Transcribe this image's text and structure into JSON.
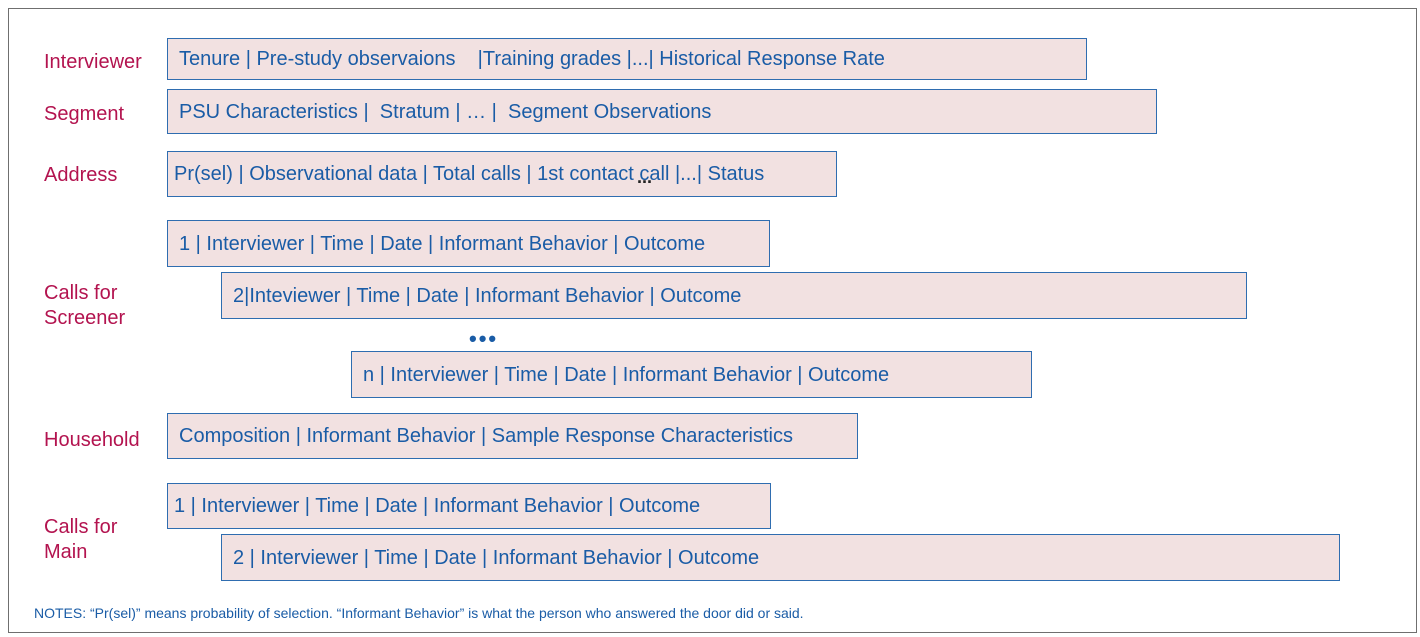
{
  "labels": {
    "interviewer": "Interviewer",
    "segment": "Segment",
    "address": "Address",
    "calls_screener_line1": "Calls for",
    "calls_screener_line2": "Screener",
    "household": "Household",
    "calls_main_line1": "Calls for",
    "calls_main_line2": "Main"
  },
  "bars": {
    "interviewer": "Tenure | Pre-study observaions    |Training grades |...| Historical Response Rate",
    "segment": "PSU Characteristics |  Stratum | … |  Segment Observations",
    "address": "Pr(sel) | Observational data | Total calls | 1st contact call |...| Status",
    "screener_1": "1 | Interviewer | Time | Date | Informant Behavior | Outcome",
    "screener_2": "2|Inteviewer | Time | Date | Informant Behavior | Outcome",
    "screener_ellipsis": "•••",
    "screener_n": "n | Interviewer | Time | Date | Informant Behavior | Outcome",
    "household": "Composition | Informant Behavior | Sample Response Characteristics",
    "main_1": "1 | Interviewer | Time | Date | Informant Behavior | Outcome",
    "main_2": "2 | Interviewer | Time | Date | Informant Behavior | Outcome"
  },
  "stray_mark": "...",
  "notes": "NOTES: “Pr(sel)” means probability of selection. “Informant Behavior” is what the person who answered the door did or said.",
  "colors": {
    "label": "#b3134f",
    "bar_text": "#1a5ca6",
    "bar_fill": "#f2e1e1",
    "bar_border": "#2f6db0"
  }
}
